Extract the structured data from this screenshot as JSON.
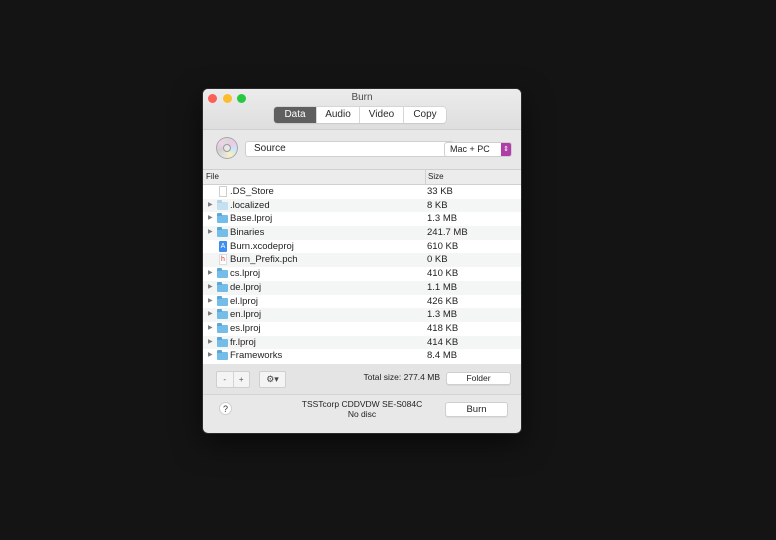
{
  "window": {
    "title": "Burn"
  },
  "tabs": [
    {
      "label": "Data",
      "active": true
    },
    {
      "label": "Audio",
      "active": false
    },
    {
      "label": "Video",
      "active": false
    },
    {
      "label": "Copy",
      "active": false
    }
  ],
  "source": {
    "value": "Source",
    "icon": "disc-icon"
  },
  "filesystem": {
    "selected": "Mac + PC"
  },
  "table": {
    "columns": [
      "File",
      "Size"
    ],
    "rows": [
      {
        "name": ".DS_Store",
        "size": "33 KB",
        "type": "file",
        "expandable": false
      },
      {
        "name": ".localized",
        "size": "8 KB",
        "type": "folder-light",
        "expandable": true
      },
      {
        "name": "Base.lproj",
        "size": "1.3 MB",
        "type": "folder",
        "expandable": true
      },
      {
        "name": "Binaries",
        "size": "241.7 MB",
        "type": "folder",
        "expandable": true
      },
      {
        "name": "Burn.xcodeproj",
        "size": "610 KB",
        "type": "xcodeproj",
        "expandable": false
      },
      {
        "name": "Burn_Prefix.pch",
        "size": "0 KB",
        "type": "header",
        "expandable": false
      },
      {
        "name": "cs.lproj",
        "size": "410 KB",
        "type": "folder",
        "expandable": true
      },
      {
        "name": "de.lproj",
        "size": "1.1 MB",
        "type": "folder",
        "expandable": true
      },
      {
        "name": "el.lproj",
        "size": "426 KB",
        "type": "folder",
        "expandable": true
      },
      {
        "name": "en.lproj",
        "size": "1.3 MB",
        "type": "folder",
        "expandable": true
      },
      {
        "name": "es.lproj",
        "size": "418 KB",
        "type": "folder",
        "expandable": true
      },
      {
        "name": "fr.lproj",
        "size": "414 KB",
        "type": "folder",
        "expandable": true
      },
      {
        "name": "Frameworks",
        "size": "8.4 MB",
        "type": "folder",
        "expandable": true
      }
    ]
  },
  "toolbar": {
    "remove_label": "-",
    "add_label": "+",
    "gear_label": "⚙▾",
    "total_size": "Total size: 277.4 MB",
    "folder_label": "Folder"
  },
  "footer": {
    "help_label": "?",
    "drive_name": "TSSTcorp CDDVDW SE-S084C",
    "disc_status": "No disc",
    "burn_label": "Burn"
  },
  "colors": {
    "active_tab": "#5f5f5f",
    "select_stepper": "#b03ea8",
    "folder": "#74bde8"
  }
}
